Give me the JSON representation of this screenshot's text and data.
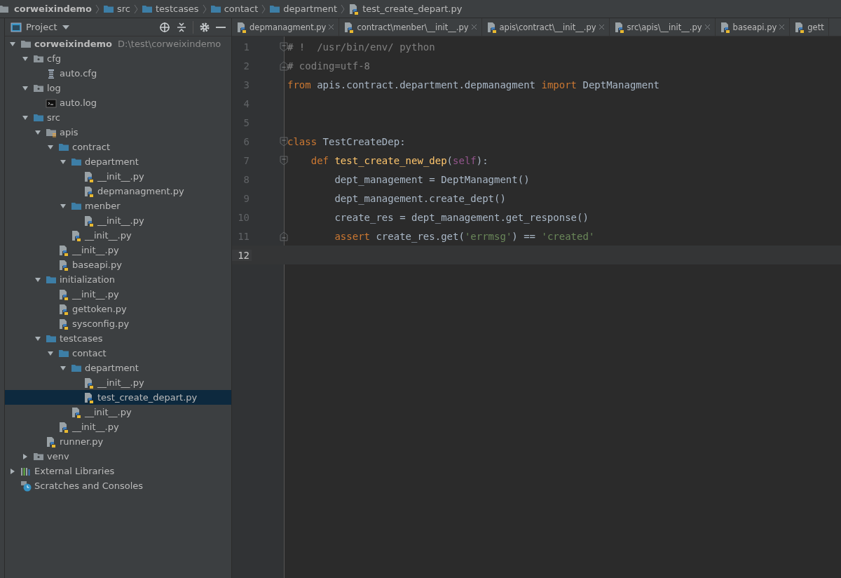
{
  "breadcrumbs": [
    {
      "label": "corweixindemo",
      "kind": "project"
    },
    {
      "label": "src",
      "kind": "folder"
    },
    {
      "label": "testcases",
      "kind": "folder"
    },
    {
      "label": "contact",
      "kind": "folder"
    },
    {
      "label": "department",
      "kind": "folder"
    },
    {
      "label": "test_create_depart.py",
      "kind": "pyfile"
    }
  ],
  "project_panel": {
    "title": "Project"
  },
  "tree": [
    {
      "label": "corweixindemo",
      "path": "D:\\test\\corweixindemo",
      "kind": "root",
      "expanded": true,
      "selected": false,
      "children": [
        {
          "label": "cfg",
          "kind": "plainfolder",
          "expanded": true,
          "selected": false,
          "children": [
            {
              "label": "auto.cfg",
              "kind": "cfg",
              "selected": false
            }
          ]
        },
        {
          "label": "log",
          "kind": "plainfolder",
          "expanded": true,
          "selected": false,
          "children": [
            {
              "label": "auto.log",
              "kind": "log",
              "selected": false
            }
          ]
        },
        {
          "label": "src",
          "kind": "folder",
          "expanded": true,
          "selected": false,
          "children": [
            {
              "label": "apis",
              "kind": "package",
              "expanded": true,
              "selected": false,
              "children": [
                {
                  "label": "contract",
                  "kind": "folder",
                  "expanded": true,
                  "selected": false,
                  "children": [
                    {
                      "label": "department",
                      "kind": "folder",
                      "expanded": true,
                      "selected": false,
                      "children": [
                        {
                          "label": "__init__.py",
                          "kind": "py",
                          "selected": false
                        },
                        {
                          "label": "depmanagment.py",
                          "kind": "py",
                          "selected": false
                        }
                      ]
                    },
                    {
                      "label": "menber",
                      "kind": "folder",
                      "expanded": true,
                      "selected": false,
                      "children": [
                        {
                          "label": "__init__.py",
                          "kind": "py",
                          "selected": false
                        }
                      ]
                    },
                    {
                      "label": "__init__.py",
                      "kind": "py",
                      "selected": false
                    }
                  ]
                },
                {
                  "label": "__init__.py",
                  "kind": "py",
                  "selected": false
                },
                {
                  "label": "baseapi.py",
                  "kind": "py",
                  "selected": false
                }
              ]
            },
            {
              "label": "initialization",
              "kind": "folder",
              "expanded": true,
              "selected": false,
              "children": [
                {
                  "label": "__init__.py",
                  "kind": "py",
                  "selected": false
                },
                {
                  "label": "gettoken.py",
                  "kind": "py",
                  "selected": false
                },
                {
                  "label": "sysconfig.py",
                  "kind": "py",
                  "selected": false
                }
              ]
            },
            {
              "label": "testcases",
              "kind": "folder",
              "expanded": true,
              "selected": false,
              "children": [
                {
                  "label": "contact",
                  "kind": "folder",
                  "expanded": true,
                  "selected": false,
                  "children": [
                    {
                      "label": "department",
                      "kind": "folder",
                      "expanded": true,
                      "selected": false,
                      "children": [
                        {
                          "label": "__init__.py",
                          "kind": "py",
                          "selected": false
                        },
                        {
                          "label": "test_create_depart.py",
                          "kind": "py",
                          "selected": true
                        }
                      ]
                    },
                    {
                      "label": "__init__.py",
                      "kind": "py",
                      "selected": false
                    }
                  ]
                },
                {
                  "label": "__init__.py",
                  "kind": "py",
                  "selected": false
                }
              ]
            },
            {
              "label": "runner.py",
              "kind": "py",
              "selected": false
            }
          ]
        },
        {
          "label": "venv",
          "kind": "plainfolder",
          "expanded": false,
          "selected": false
        }
      ]
    },
    {
      "label": "External Libraries",
      "kind": "libraries",
      "expanded": false,
      "selected": false
    },
    {
      "label": "Scratches and Consoles",
      "kind": "scratches",
      "selected": false
    }
  ],
  "tabs": [
    {
      "label": "depmanagment.py",
      "selected": false,
      "closable": true
    },
    {
      "label": "contract\\menber\\__init__.py",
      "selected": false,
      "closable": true
    },
    {
      "label": "apis\\contract\\__init__.py",
      "selected": false,
      "closable": true
    },
    {
      "label": "src\\apis\\__init__.py",
      "selected": false,
      "closable": true
    },
    {
      "label": "baseapi.py",
      "selected": false,
      "closable": true
    },
    {
      "label": "gett",
      "selected": false,
      "closable": false
    }
  ],
  "code_lines": [
    {
      "number": "1",
      "fold_start": true,
      "fold_end": false,
      "current": false,
      "tokens": [
        {
          "t": "# !  /usr/bin/env/ python",
          "kind": "comment"
        }
      ]
    },
    {
      "number": "2",
      "fold_start": false,
      "fold_end": true,
      "current": false,
      "tokens": [
        {
          "t": "# coding=utf-8",
          "kind": "comment"
        }
      ]
    },
    {
      "number": "3",
      "current": false,
      "tokens": [
        {
          "t": "from",
          "kind": "keyword"
        },
        {
          "t": " apis.contract.department.depmanagment ",
          "kind": "plain"
        },
        {
          "t": "import",
          "kind": "keyword"
        },
        {
          "t": " DeptManagment",
          "kind": "plain"
        }
      ]
    },
    {
      "number": "4",
      "current": false
    },
    {
      "number": "5",
      "current": false
    },
    {
      "number": "6",
      "fold_start": true,
      "fold_end": false,
      "current": false,
      "tokens": [
        {
          "t": "class",
          "kind": "keyword"
        },
        {
          "t": " TestCreateDep:",
          "kind": "plain"
        }
      ]
    },
    {
      "number": "7",
      "fold_start": true,
      "fold_end": false,
      "current": false,
      "tokens": [
        {
          "t": "    def",
          "kind": "keyword"
        },
        {
          "t": " test_create_new_dep",
          "kind": "function"
        },
        {
          "t": "(",
          "kind": "plain"
        },
        {
          "t": "self",
          "kind": "self"
        },
        {
          "t": "):",
          "kind": "plain"
        }
      ]
    },
    {
      "number": "8",
      "current": false,
      "tokens": [
        {
          "t": "        dept_management = DeptManagment()",
          "kind": "plain"
        }
      ]
    },
    {
      "number": "9",
      "current": false,
      "tokens": [
        {
          "t": "        dept_management.create_dept()",
          "kind": "plain"
        }
      ]
    },
    {
      "number": "10",
      "current": false,
      "tokens": [
        {
          "t": "        create_res = dept_management.get_response()",
          "kind": "plain"
        }
      ]
    },
    {
      "number": "11",
      "fold_start": false,
      "fold_end": true,
      "current": false,
      "tokens": [
        {
          "t": "        assert",
          "kind": "keyword"
        },
        {
          "t": " create_res.get(",
          "kind": "plain"
        },
        {
          "t": "'errmsg'",
          "kind": "string"
        },
        {
          "t": ") == ",
          "kind": "plain"
        },
        {
          "t": "'created'",
          "kind": "string"
        }
      ]
    },
    {
      "number": "12",
      "current": true
    }
  ]
}
